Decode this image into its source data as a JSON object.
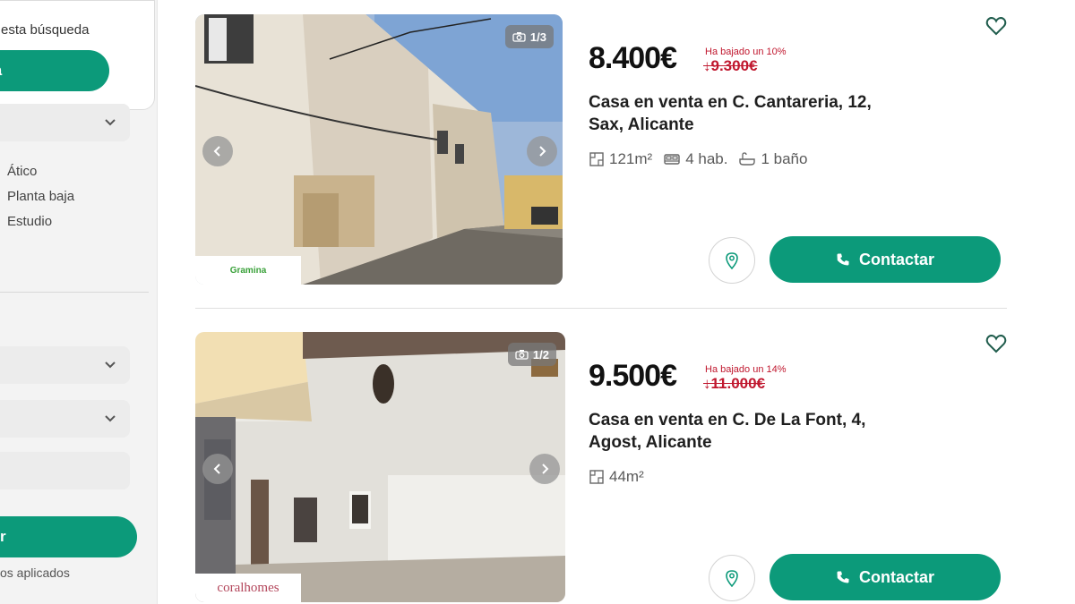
{
  "sidebar": {
    "alert_text": "esta búsqueda",
    "alert_button": "erta",
    "type_options": [
      "Ático",
      "Planta baja",
      "Estudio"
    ],
    "search_button": "r",
    "filters_text": "os aplicados"
  },
  "listings": [
    {
      "photo_count": "1/3",
      "agency": "Gramina",
      "price": "8.400€",
      "drop_label": "Ha bajado un 10%",
      "old_price": "9.300€",
      "title": "Casa en venta en C. Cantareria, 12, Sax, Alicante",
      "area": "121m²",
      "rooms": "4 hab.",
      "baths": "1 baño",
      "contact_label": "Contactar"
    },
    {
      "photo_count": "1/2",
      "agency": "coralhomes",
      "price": "9.500€",
      "drop_label": "Ha bajado un 14%",
      "old_price": "11.000€",
      "title": "Casa en venta en C. De La Font, 4, Agost, Alicante",
      "area": "44m²",
      "contact_label": "Contactar"
    }
  ],
  "colors": {
    "accent": "#0c9a7a",
    "price_drop": "#c0172e"
  }
}
